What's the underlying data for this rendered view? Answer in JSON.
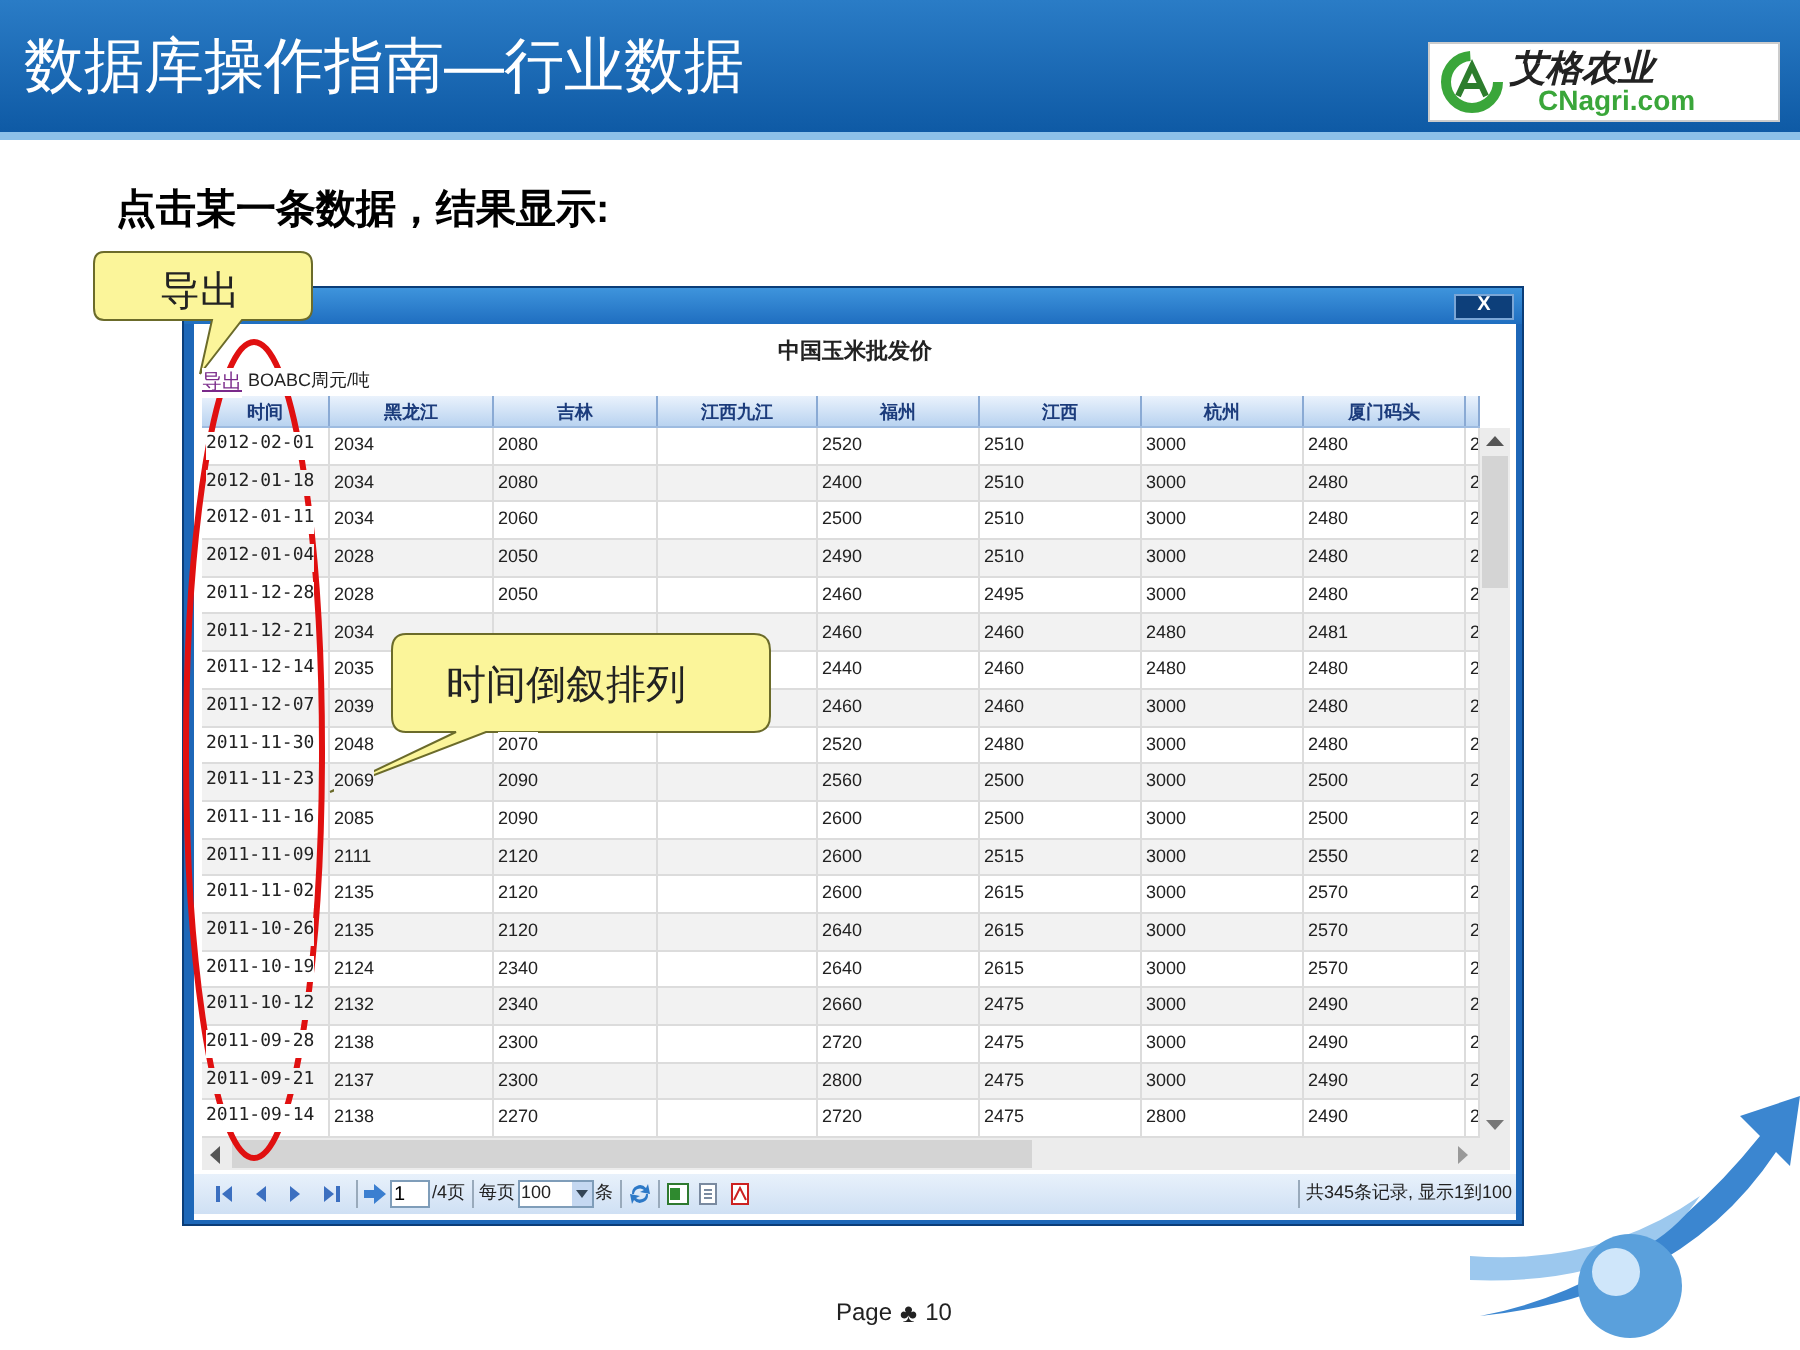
{
  "slide": {
    "title": "数据库操作指南—行业数据",
    "logo": {
      "name": "艾格农业",
      "domain": "CNagri.com"
    },
    "subtitle": "点击某一条数据，结果显示:",
    "footer": {
      "label": "Page",
      "symbol": "♣",
      "number": "10"
    }
  },
  "callouts": [
    {
      "text": "导出"
    },
    {
      "text": "时间倒叙排列"
    }
  ],
  "window": {
    "close": "X",
    "title": "中国玉米批发价",
    "export_link": "导出",
    "unit": "BOABC周元/吨",
    "columns": [
      "时间",
      "黑龙江",
      "吉林",
      "江西九江",
      "福州",
      "江西",
      "杭州",
      "厦门码头"
    ],
    "rows": [
      [
        "2012-02-01",
        "2034",
        "2080",
        null,
        "2520",
        "2510",
        "3000",
        "2480",
        "2"
      ],
      [
        "2012-01-18",
        "2034",
        "2080",
        null,
        "2400",
        "2510",
        "3000",
        "2480",
        "2"
      ],
      [
        "2012-01-11",
        "2034",
        "2060",
        null,
        "2500",
        "2510",
        "3000",
        "2480",
        "2"
      ],
      [
        "2012-01-04",
        "2028",
        "2050",
        null,
        "2490",
        "2510",
        "3000",
        "2480",
        "2"
      ],
      [
        "2011-12-28",
        "2028",
        "2050",
        null,
        "2460",
        "2495",
        "3000",
        "2480",
        "2"
      ],
      [
        "2011-12-21",
        "2034",
        null,
        null,
        "2460",
        "2460",
        "2480",
        "2481",
        "2"
      ],
      [
        "2011-12-14",
        "2035",
        null,
        null,
        "2440",
        "2460",
        "2480",
        "2480",
        "2"
      ],
      [
        "2011-12-07",
        "2039",
        null,
        null,
        "2460",
        "2460",
        "3000",
        "2480",
        "2"
      ],
      [
        "2011-11-30",
        "2048",
        "2070",
        null,
        "2520",
        "2480",
        "3000",
        "2480",
        "2"
      ],
      [
        "2011-11-23",
        "2069",
        "2090",
        null,
        "2560",
        "2500",
        "3000",
        "2500",
        "2"
      ],
      [
        "2011-11-16",
        "2085",
        "2090",
        null,
        "2600",
        "2500",
        "3000",
        "2500",
        "2"
      ],
      [
        "2011-11-09",
        "2111",
        "2120",
        null,
        "2600",
        "2515",
        "3000",
        "2550",
        "2"
      ],
      [
        "2011-11-02",
        "2135",
        "2120",
        null,
        "2600",
        "2615",
        "3000",
        "2570",
        "2"
      ],
      [
        "2011-10-26",
        "2135",
        "2120",
        null,
        "2640",
        "2615",
        "3000",
        "2570",
        "2"
      ],
      [
        "2011-10-19",
        "2124",
        "2340",
        null,
        "2640",
        "2615",
        "3000",
        "2570",
        "2"
      ],
      [
        "2011-10-12",
        "2132",
        "2340",
        null,
        "2660",
        "2475",
        "3000",
        "2490",
        "2"
      ],
      [
        "2011-09-28",
        "2138",
        "2300",
        null,
        "2720",
        "2475",
        "3000",
        "2490",
        "2"
      ],
      [
        "2011-09-21",
        "2137",
        "2300",
        null,
        "2800",
        "2475",
        "3000",
        "2490",
        "2"
      ],
      [
        "2011-09-14",
        "2138",
        "2270",
        null,
        "2720",
        "2475",
        "2800",
        "2490",
        "2"
      ]
    ],
    "pager": {
      "page": "1",
      "pages": "/4页",
      "per_page_label": "每页",
      "per_page": "100",
      "per_page_unit": "条",
      "summary": "共345条记录, 显示1到100"
    }
  }
}
